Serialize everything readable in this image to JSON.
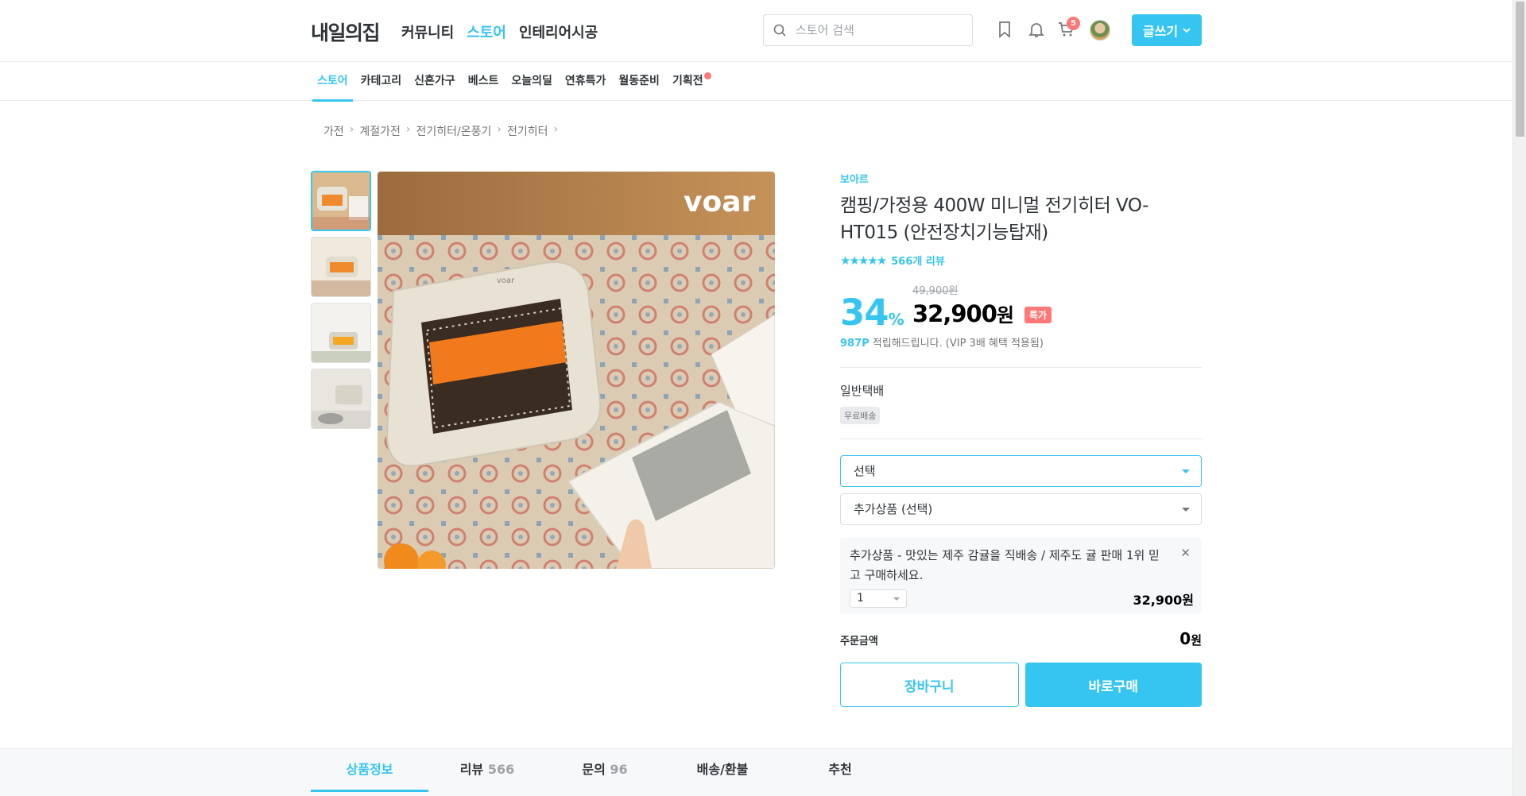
{
  "header": {
    "logo": "내일의집",
    "nav": [
      "커뮤니티",
      "스토어",
      "인테리어시공"
    ],
    "search_placeholder": "스토어 검색",
    "cart_count": "5",
    "write_label": "글쓰기"
  },
  "subnav": [
    "스토어",
    "카테고리",
    "신혼가구",
    "베스트",
    "오늘의딜",
    "연휴특가",
    "월동준비",
    "기획전"
  ],
  "breadcrumb": [
    "가전",
    "계절가전",
    "전기히터/온풍기",
    "전기히터"
  ],
  "product": {
    "brand": "보아르",
    "name": "캠핑/가정용 400W 미니멀 전기히터 VO-HT015 (안전장치기능탑재)",
    "image_logo": "voar",
    "stars": "★★★★★",
    "review_text": "566개 리뷰",
    "original_price": "49,900원",
    "discount": "34",
    "discount_unit": "%",
    "price": "32,900",
    "price_unit": "원",
    "special_tag": "특가",
    "points_value": "987P",
    "points_text": " 적립해드립니다. (VIP 3배 혜택 적용됨)"
  },
  "shipping": {
    "title": "일반택배",
    "badge": "무료배송"
  },
  "options": {
    "select": "선택",
    "addon_select": "추가상품 (선택)"
  },
  "addon": {
    "desc": "추가상품 - 맛있는 제주 감귤을 직배송 / 제주도 귤 판매 1위 믿고 구매하세요.",
    "qty": "1",
    "price": "32,900원"
  },
  "order": {
    "label": "주문금액",
    "value": "0",
    "unit": "원"
  },
  "buttons": {
    "cart": "장바구니",
    "buy": "바로구매"
  },
  "tabs": [
    {
      "label": "상품정보",
      "count": ""
    },
    {
      "label": "리뷰",
      "count": "566"
    },
    {
      "label": "문의",
      "count": "96"
    },
    {
      "label": "배송/환불",
      "count": ""
    },
    {
      "label": "추천",
      "count": ""
    }
  ],
  "colors": {
    "accent": "#35c5f0",
    "badge": "#ff7777"
  }
}
